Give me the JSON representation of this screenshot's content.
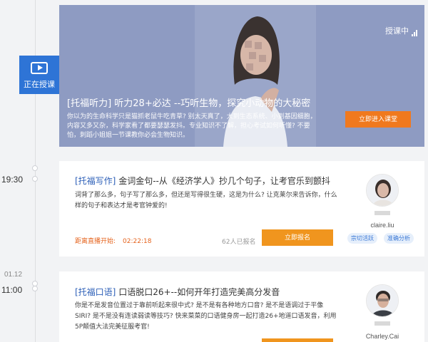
{
  "live_badge": {
    "label": "正在授课",
    "icon": "play-screen-icon"
  },
  "hero": {
    "status": "授课中",
    "status_icon": "signal-bars-icon",
    "title": "[托福听力] 听力28+必达 --巧听生物，探究小动物的大秘密",
    "description": "你以为的生命科学只是猫抓老鼠牛吃青草? 别太天真了，大到生态系统、小到基因细胞，内容又多又杂，科学家看了都要瑟瑟发抖。专业知识不了解，担心考试如何听懂? 不要怕，刺蹈小姐姐一节课教你必会生物知识。",
    "enter_button": "立即进入课堂",
    "bg_color": "#8e9bc2"
  },
  "timeline": {
    "times": [
      "19:30",
      "11:00"
    ],
    "date": "01.12"
  },
  "courses": [
    {
      "tag": "[托福写作]",
      "title": "金词金句--从《经济学人》抄几个句子，让考官乐到颤抖",
      "description": "词背了那么多，句子写了那么多，但还是写得很生硬，这是为什么? 让克莱尔来告诉你，什么样的句子和表达才是考官钟爱的!",
      "countdown_label": "距离直播开始:",
      "countdown_value": "02:22:18",
      "enrolled": "62人已报名",
      "button": "立即报名",
      "teacher": "claire.liu",
      "badges": [
        "宗切活跃",
        "准确分析"
      ]
    },
    {
      "tag": "[托福口语]",
      "title": "口语脱口26+--如何开年打造完美高分发音",
      "description": "你是不是发音位置过于靠前听起来很中式? 是不是有各种地方口音? 是不是语调过于平像SIRI? 是不是没有连读弱读等技巧? 快来菜菜的口语健身房一起打造26+地道口语发音，利用5P颠值大法完美征服考官!",
      "teacher": "Charley.Cai"
    }
  ]
}
